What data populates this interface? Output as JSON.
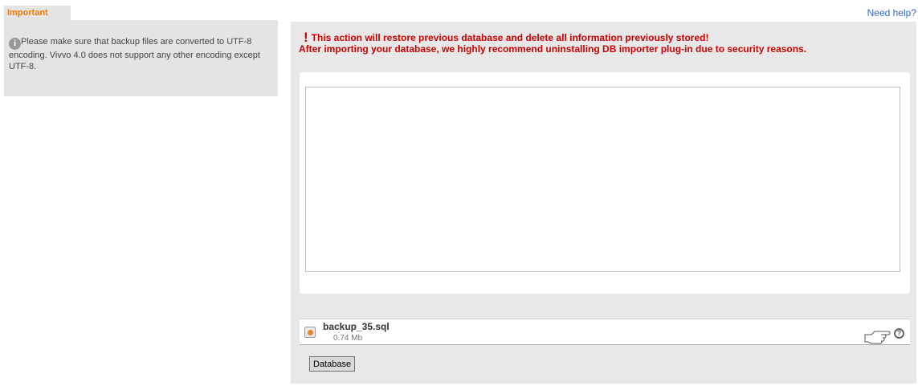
{
  "sidebar": {
    "tab_label": "Important",
    "info_icon": "info-icon",
    "message": "Please make sure that backup files are converted to UTF-8 encoding. Vivvo 4.0 does not support any other encoding except UTF-8."
  },
  "header": {
    "help_link": "Need help?"
  },
  "main": {
    "warning_mark": "!",
    "warning_line1": "This action will restore previous database and delete all information previously stored!",
    "warning_line2": "After importing your database, we highly recommend uninstalling DB importer plug-in due to security reasons.",
    "textarea_value": "",
    "file": {
      "icon": "sql-file-icon",
      "name": "backup_35.sql",
      "size": "0.74 Mb",
      "pointer_icon": "hand-pointer-icon",
      "help_icon": "question-icon"
    },
    "button_label": "Database"
  },
  "colors": {
    "warning": "#cc0000",
    "tab_text": "#f07a00",
    "link": "#3366cc",
    "panel_bg": "#e8e8e8"
  }
}
